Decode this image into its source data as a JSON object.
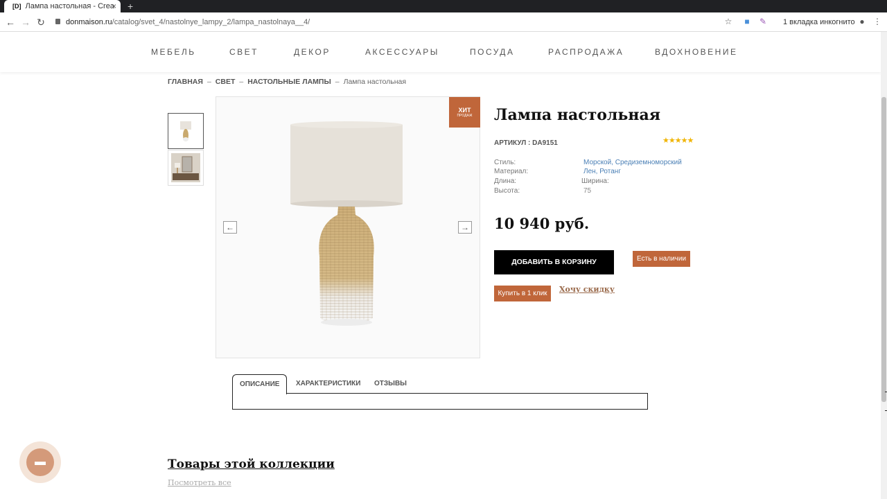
{
  "browser": {
    "tab_title": "Лампа настольная - Crea",
    "tab_favicon": "[D]",
    "url_host": "donmaison.ru",
    "url_path": "/catalog/svet_4/nastolnye_lampy_2/lampa_nastolnaya__4/",
    "incognito_label": "1 вкладка инкогнито"
  },
  "nav": {
    "items": [
      "МЕБЕЛЬ",
      "СВЕТ",
      "ДЕКОР",
      "АКСЕССУАРЫ",
      "ПОСУДА",
      "РАСПРОДАЖА",
      "ВДОХНОВЕНИЕ"
    ]
  },
  "breadcrumb": {
    "items": [
      "ГЛАВНАЯ",
      "СВЕТ",
      "НАСТОЛЬНЫЕ ЛАМПЫ"
    ],
    "current": "Лампа настольная",
    "separator": "–"
  },
  "product": {
    "badge_line1": "ХИТ",
    "badge_line2": "ПРОДАЖ",
    "title": "Лампа настольная",
    "sku": "АРТИКУЛ : DA9151",
    "rating_stars": "★★★★★",
    "rating": 5,
    "specs": {
      "style_label": "Стиль:",
      "style_value": "Морской, Средиземноморский",
      "material_label": "Материал:",
      "material_value": "Лен, Ротанг",
      "length_label": "Длина:",
      "width_label": "Ширина:",
      "height_label": "Высота:",
      "height_value": "75"
    },
    "price": "10 940 руб.",
    "add_to_cart": "ДОБАВИТЬ В КОРЗИНУ",
    "in_stock": "Есть в наличии",
    "buy_one_click": "Купить в 1 клик",
    "want_discount": "Хочу скидку"
  },
  "tabs": [
    "ОПИСАНИЕ",
    "ХАРАКТЕРИСТИКИ",
    "ОТЗЫВЫ"
  ],
  "collection": {
    "title": "Товары этой коллекции",
    "view_all": "Посмотреть все"
  },
  "colors": {
    "accent": "#c0663a",
    "link": "#4a7fb5",
    "star": "#f0b400"
  }
}
